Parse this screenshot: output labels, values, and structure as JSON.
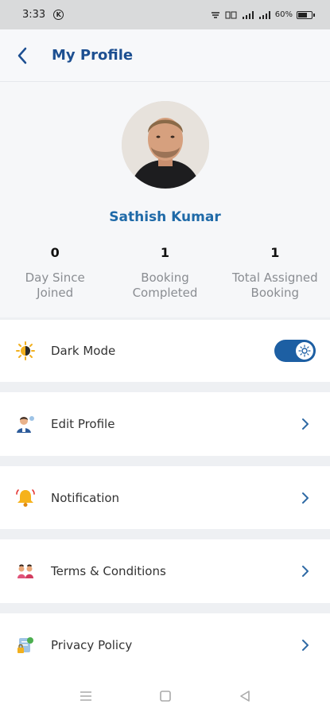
{
  "status_bar": {
    "time": "3:33",
    "battery": "60%"
  },
  "header": {
    "title": "My Profile",
    "back_icon": "chevron-left-icon"
  },
  "profile": {
    "name": "Sathish Kumar",
    "stats": [
      {
        "value": "0",
        "label_line1": "Day Since",
        "label_line2": "Joined"
      },
      {
        "value": "1",
        "label_line1": "Booking",
        "label_line2": "Completed"
      },
      {
        "value": "1",
        "label_line1": "Total Assigned",
        "label_line2": "Booking"
      }
    ]
  },
  "menu": {
    "dark_mode": {
      "label": "Dark Mode",
      "icon": "sun-moon-icon",
      "enabled": true
    },
    "items": [
      {
        "label": "Edit Profile",
        "icon": "edit-user-icon"
      },
      {
        "label": "Notification",
        "icon": "bell-icon"
      },
      {
        "label": "Terms & Conditions",
        "icon": "document-user-icon"
      },
      {
        "label": "Privacy Policy",
        "icon": "privacy-icon"
      }
    ]
  },
  "colors": {
    "accent": "#1d4f91",
    "name": "#1f6aa8",
    "toggle": "#1d5fa3",
    "chevron": "#2f6aa5"
  }
}
